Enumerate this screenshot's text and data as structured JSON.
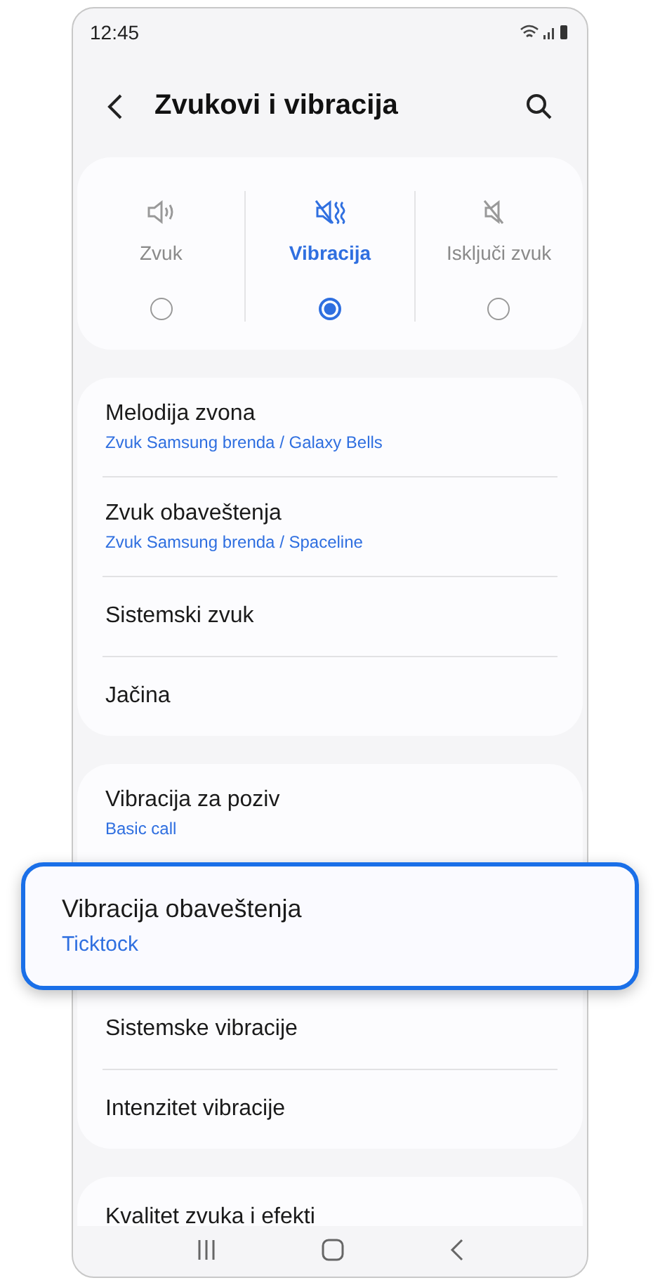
{
  "status_bar": {
    "time": "12:45"
  },
  "header": {
    "title": "Zvukovi i vibracija"
  },
  "sound_modes": [
    {
      "label": "Zvuk",
      "kind": "sound",
      "selected": false
    },
    {
      "label": "Vibracija",
      "kind": "vibrate",
      "selected": true
    },
    {
      "label": "Isključi zvuk",
      "kind": "mute",
      "selected": false
    }
  ],
  "groups": [
    {
      "items": [
        {
          "title": "Melodija zvona",
          "subtitle": "Zvuk Samsung brenda / Galaxy Bells",
          "highlighted": false
        },
        {
          "title": "Zvuk obaveštenja",
          "subtitle": "Zvuk Samsung brenda / Spaceline",
          "highlighted": false
        },
        {
          "title": "Sistemski zvuk",
          "highlighted": false
        },
        {
          "title": "Jačina",
          "highlighted": false
        }
      ]
    },
    {
      "items": [
        {
          "title": "Vibracija za poziv",
          "subtitle": "Basic call",
          "highlighted": false
        },
        {
          "title": "Vibracija obaveštenja",
          "subtitle": "Ticktock",
          "highlighted": true
        },
        {
          "title": "Sistemske vibracije",
          "highlighted": false
        },
        {
          "title": "Intenzitet vibracije",
          "highlighted": false
        }
      ]
    },
    {
      "items": [
        {
          "title": "Kvalitet zvuka i efekti",
          "highlighted": false
        }
      ]
    }
  ]
}
